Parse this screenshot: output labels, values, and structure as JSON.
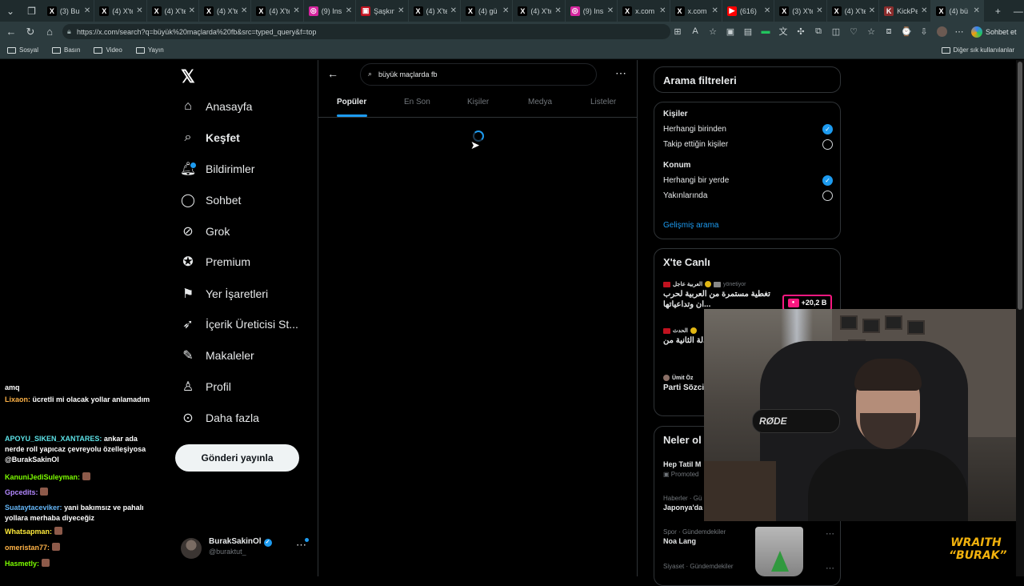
{
  "browser": {
    "tabs": [
      {
        "label": "(3) Bu",
        "icon": "x-icon",
        "color": "#000000"
      },
      {
        "label": "(4) X'te",
        "icon": "x-icon",
        "color": "#000000"
      },
      {
        "label": "(4) X'te",
        "icon": "x-icon",
        "color": "#000000"
      },
      {
        "label": "(4) X'te",
        "icon": "x-icon",
        "color": "#000000"
      },
      {
        "label": "(4) X'te",
        "icon": "x-icon",
        "color": "#000000"
      },
      {
        "label": "(9) Ins",
        "icon": "instagram-icon",
        "color": "#d6249f"
      },
      {
        "label": "Şaşkın",
        "icon": "tv-icon",
        "color": "#c1121f"
      },
      {
        "label": "(4) X'te",
        "icon": "x-icon",
        "color": "#000000"
      },
      {
        "label": "(4) gü",
        "icon": "x-icon",
        "color": "#000000"
      },
      {
        "label": "(4) X'te",
        "icon": "x-icon",
        "color": "#000000"
      },
      {
        "label": "(9) Ins",
        "icon": "instagram-icon",
        "color": "#d6249f"
      },
      {
        "label": "x.com",
        "icon": "x-icon",
        "color": "#000000"
      },
      {
        "label": "x.com",
        "icon": "x-icon",
        "color": "#000000"
      },
      {
        "label": "(616)",
        "icon": "youtube-icon",
        "color": "#ff0000"
      },
      {
        "label": "(3) X'te",
        "icon": "x-icon",
        "color": "#000000"
      },
      {
        "label": "(4) X'te",
        "icon": "x-icon",
        "color": "#000000"
      },
      {
        "label": "KickPe",
        "icon": "kick-icon",
        "color": "#8b2c2c"
      },
      {
        "label": "(4) bü",
        "icon": "x-icon",
        "color": "#000000"
      }
    ],
    "url": "https://x.com/search?q=büyük%20maçlarda%20fb&src=typed_query&f=top",
    "chat_button": "Sohbet et",
    "bookmarks": [
      "Sosyal",
      "Basın",
      "Video",
      "Yayın"
    ],
    "other_bookmarks": "Diğer sık kullanılanlar"
  },
  "nav": {
    "items": [
      {
        "label": "Anasayfa",
        "icon": "home-icon"
      },
      {
        "label": "Keşfet",
        "icon": "search-icon"
      },
      {
        "label": "Bildirimler",
        "icon": "bell-icon"
      },
      {
        "label": "Sohbet",
        "icon": "chat-icon"
      },
      {
        "label": "Grok",
        "icon": "grok-icon"
      },
      {
        "label": "Premium",
        "icon": "premium-icon"
      },
      {
        "label": "Yer İşaretleri",
        "icon": "bookmark-icon"
      },
      {
        "label": "İçerik Üreticisi St...",
        "icon": "rocket-icon"
      },
      {
        "label": "Makaleler",
        "icon": "article-icon"
      },
      {
        "label": "Profil",
        "icon": "profile-icon"
      },
      {
        "label": "Daha fazla",
        "icon": "more-circle-icon"
      }
    ],
    "post_button": "Gönderi yayınla",
    "account": {
      "name": "BurakSakinOl",
      "handle": "@buraktut_"
    }
  },
  "search": {
    "query": "büyük maçlarda fb",
    "tabs": [
      "Popüler",
      "En Son",
      "Kişiler",
      "Medya",
      "Listeler"
    ],
    "active_tab": "Popüler"
  },
  "filters": {
    "title": "Arama filtreleri",
    "people_title": "Kişiler",
    "people_options": [
      "Herhangi birinden",
      "Takip ettiğin kişiler"
    ],
    "location_title": "Konum",
    "location_options": [
      "Herhangi bir yerde",
      "Yakınlarında"
    ],
    "advanced": "Gelişmiş arama"
  },
  "live": {
    "title": "X'te Canlı",
    "items": [
      {
        "source": "العربية عاجل",
        "status": "yönetiyor",
        "text": "تغطية مستمرة من العربية لحرب ...ان وتداعياتها"
      },
      {
        "source": "الحدث",
        "status": "",
        "text": "طهران ترفض ...لة الثانية من"
      },
      {
        "source": "Ümit Öz",
        "status": "",
        "text": "Parti Sözci... Karamahm..."
      }
    ],
    "badge": "+20,2 B"
  },
  "whatsup": {
    "title": "Neler ol",
    "trends": [
      {
        "category": "",
        "title": "Hep Tatil M",
        "promoted": "Promoted"
      },
      {
        "category": "Haberler · Gü",
        "title": "Japonya'da",
        "promoted": ""
      },
      {
        "category": "Spor · Gündemdekiler",
        "title": "Noa Lang",
        "promoted": ""
      },
      {
        "category": "Siyaset · Gündemdekiler",
        "title": "",
        "promoted": ""
      }
    ]
  },
  "chat": {
    "messages": [
      {
        "user": "",
        "user_color": "#ffffff",
        "text": "amq"
      },
      {
        "user": "Lixaon:",
        "user_color": "#ffb347",
        "text": "ücretli mi olacak yollar anlamadım"
      },
      {
        "user": "APOYU_SIKEN_XANTARES:",
        "user_color": "#5ce1e6",
        "text": "ankar ada nerde roll yapıcaz çevreyolu özelleşiyosa @BurakSakinOl"
      },
      {
        "user": "KanuniJediSuleyman:",
        "user_color": "#7cfc00",
        "text": ""
      },
      {
        "user": "Gpcedits:",
        "user_color": "#b388ff",
        "text": ""
      },
      {
        "user": "Suataytaceviker:",
        "user_color": "#64b5f6",
        "text": "yani bakımsız ve pahalı yollara merhaba diyeceğiz"
      },
      {
        "user": "Whatsapman:",
        "user_color": "#ffeb3b",
        "text": ""
      },
      {
        "user": "omeristan77:",
        "user_color": "#ffb347",
        "text": ""
      },
      {
        "user": "Hasmetly:",
        "user_color": "#7cfc00",
        "text": ""
      }
    ]
  },
  "overlay": {
    "mic_brand": "RØDE",
    "watermark_line1": "WRAITH",
    "watermark_line2": "“BURAK”"
  },
  "colors": {
    "accent": "#1d9bf0",
    "live_badge": "#f91880"
  }
}
